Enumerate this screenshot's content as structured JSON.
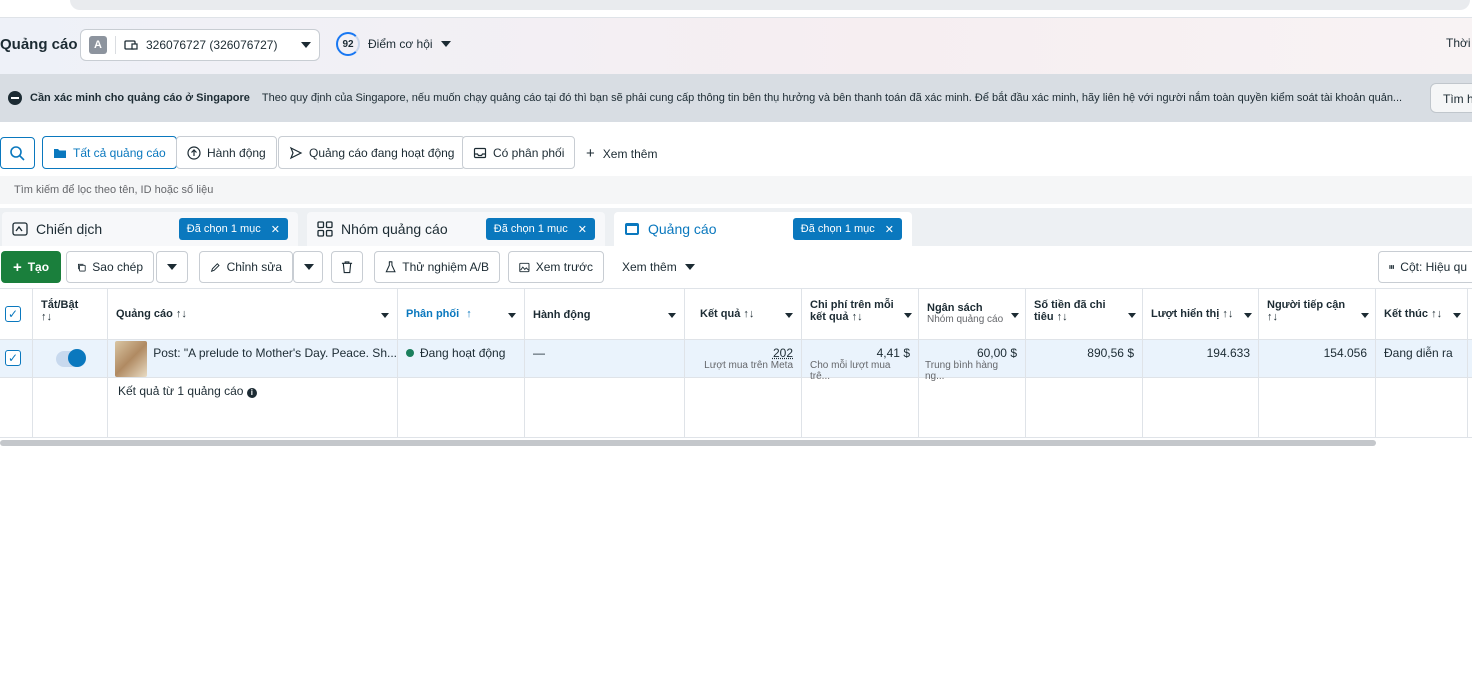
{
  "header": {
    "title": "Quảng cáo",
    "account_initial": "A",
    "account_id": "326076727 (326076727)",
    "score": "92",
    "score_label": "Điểm cơ hội",
    "time_label": "Thời"
  },
  "notice": {
    "title": "Cần xác minh cho quảng cáo ở Singapore",
    "text": "Theo quy định của Singapore, nếu muốn chạy quảng cáo tại đó thì bạn sẽ phải cung cấp thông tin bên thụ hưởng và bên thanh toán đã xác minh. Để bắt đầu xác minh, hãy liên hệ với người nắm toàn quyền kiểm soát tài khoản quản...",
    "button": "Tìm hi"
  },
  "filters": {
    "all_ads": "Tất cả quảng cáo",
    "actions": "Hành động",
    "active_ads": "Quảng cáo đang hoạt động",
    "has_delivery": "Có phân phối",
    "see_more": "Xem thêm",
    "search_placeholder": "Tìm kiếm để lọc theo tên, ID hoặc số liệu"
  },
  "tabs": [
    {
      "label": "Chiến dịch",
      "chip": "Đã chọn 1 mục"
    },
    {
      "label": "Nhóm quảng cáo",
      "chip": "Đã chọn 1 mục"
    },
    {
      "label": "Quảng cáo",
      "chip": "Đã chọn 1 mục"
    }
  ],
  "toolbar": {
    "create": "Tạo",
    "duplicate": "Sao chép",
    "edit": "Chỉnh sửa",
    "ab_test": "Thử nghiệm A/B",
    "preview": "Xem trước",
    "view": "Xem thêm",
    "columns": "Cột: Hiệu qu"
  },
  "table": {
    "headers": {
      "toggle": "Tắt/Bật",
      "ad": "Quảng cáo",
      "delivery": "Phân phối",
      "actions": "Hành động",
      "results": "Kết quả",
      "cost_line1": "Chi phí trên mỗi",
      "cost_line2": "kết quả",
      "budget": "Ngân sách",
      "budget_sub": "Nhóm quảng cáo",
      "spent_line1": "Số tiền đã chi",
      "spent_line2": "tiêu",
      "impressions": "Lượt hiển thị",
      "reach_line1": "Người tiếp cận",
      "end": "Kết thúc",
      "sort_glyph": "↑↓",
      "asc_glyph": "↑"
    },
    "row": {
      "ad_name": "Post: \"A prelude to Mother's Day. Peace. Sh...",
      "delivery": "Đang hoạt động",
      "actions": "—",
      "results": "202",
      "results_sub": "Lượt mua trên Meta",
      "cost": "4,41 $",
      "cost_sub": "Cho mỗi lượt mua trê...",
      "budget": "60,00 $",
      "budget_sub": "Trung bình hàng ng...",
      "spent": "890,56 $",
      "impressions": "194.633",
      "reach": "154.056",
      "end": "Đang diễn ra"
    },
    "summary": "Kết quả từ 1 quảng cáo"
  }
}
